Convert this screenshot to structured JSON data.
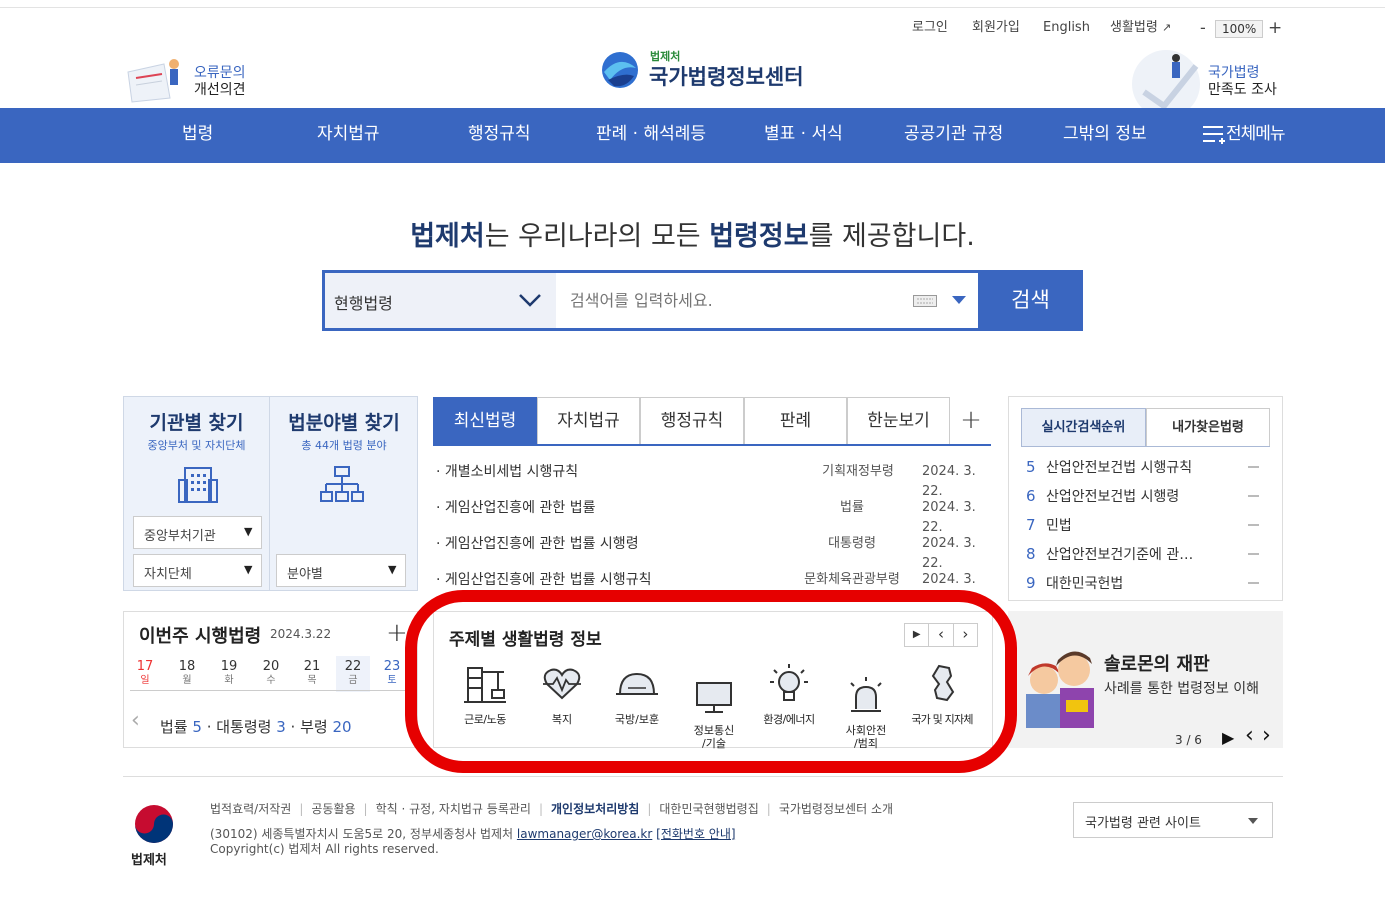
{
  "util": {
    "login": "로그인",
    "join": "회원가입",
    "english": "English",
    "life": "생활법령",
    "zoom": "100%",
    "minus": "-",
    "plus": "+"
  },
  "header": {
    "feedback1": "오류문의",
    "feedback2": "개선의견",
    "logo_small": "법제처",
    "logo": "국가법령정보센터",
    "survey1": "국가법령",
    "survey2": "만족도 조사"
  },
  "nav": [
    "법령",
    "자치법규",
    "행정규칙",
    "판례 · 해석례등",
    "별표 · 서식",
    "공공기관 규정",
    "그밖의 정보",
    "전체메뉴"
  ],
  "slogan": {
    "b1": "법제처",
    "t1": "는 우리나라의 모든 ",
    "b2": "법령정보",
    "t2": "를 제공합니다."
  },
  "search": {
    "category": "현행법령",
    "placeholder": "검색어를 입력하세요.",
    "button": "검색"
  },
  "finder": {
    "org_title": "기관별 찾기",
    "org_sub": "중앙부처 및 자치단체",
    "field_title": "법분야별 찾기",
    "field_sub": "총 44개 법령 분야",
    "sel1": "중앙부처기관",
    "sel2": "자치단체",
    "sel3": "분야별"
  },
  "tabs": [
    "최신법령",
    "자치법규",
    "행정규칙",
    "판례",
    "한눈보기",
    "+"
  ],
  "new_laws": [
    {
      "title": "· 개별소비세법 시행규칙",
      "type": "기획재정부령",
      "date": "2024. 3. 22."
    },
    {
      "title": "· 게임산업진흥에 관한 법률",
      "type": "법률",
      "date": "2024. 3. 22."
    },
    {
      "title": "· 게임산업진흥에 관한 법률 시행령",
      "type": "대통령령",
      "date": "2024. 3. 22."
    },
    {
      "title": "· 게임산업진흥에 관한 법률 시행규칙",
      "type": "문화체육관광부령",
      "date": "2024. 3. 22."
    }
  ],
  "rank": {
    "tab1": "실시간검색순위",
    "tab2": "내가찾은법령",
    "items": [
      {
        "n": "5",
        "t": "산업안전보건법 시행규칙"
      },
      {
        "n": "6",
        "t": "산업안전보건법 시행령"
      },
      {
        "n": "7",
        "t": "민법"
      },
      {
        "n": "8",
        "t": "산업안전보건기준에 관…"
      },
      {
        "n": "9",
        "t": "대한민국헌법"
      }
    ]
  },
  "week": {
    "title": "이번주 시행법령",
    "date": "2024.3.22",
    "plus": "+",
    "days": [
      {
        "d": "17",
        "w": "일"
      },
      {
        "d": "18",
        "w": "월"
      },
      {
        "d": "19",
        "w": "화"
      },
      {
        "d": "20",
        "w": "수"
      },
      {
        "d": "21",
        "w": "목"
      },
      {
        "d": "22",
        "w": "금"
      },
      {
        "d": "23",
        "w": "토"
      }
    ],
    "counts": {
      "l1": "법률",
      "c1": "5",
      "l2": "대통령령",
      "c2": "3",
      "l3": "부령",
      "c3": "20"
    }
  },
  "topics": {
    "title": "주제별 생활법령 정보",
    "items": [
      {
        "label": "근로/노동",
        "icon": "construction-icon"
      },
      {
        "label": "복지",
        "icon": "heart-icon"
      },
      {
        "label": "국방/보훈",
        "icon": "helmet-icon"
      },
      {
        "label": "정보통신\n/기술",
        "icon": "monitor-icon"
      },
      {
        "label": "환경/에너지",
        "icon": "bulb-icon"
      },
      {
        "label": "사회안전\n/범죄",
        "icon": "siren-icon"
      },
      {
        "label": "국가 및 지자체",
        "icon": "korea-map-icon"
      }
    ]
  },
  "banner": {
    "title": "솔로몬의 재판",
    "sub": "사례를 통한 법령정보 이해",
    "page": "3 / 6"
  },
  "footer": {
    "links": [
      "법적효력/저작권",
      "공동활용",
      "학칙 · 규정, 자치법규 등록관리",
      "개인정보처리방침",
      "대한민국현행법령집",
      "국가법령정보센터 소개"
    ],
    "addr": "(30102) 세종특별자치시 도움5로 20, 정부세종청사 법제처 ",
    "email": "lawmanager@korea.kr",
    "phone": "[전화번호 안내]",
    "copy": "Copyright(c) 법제처 All rights reserved.",
    "org": "법제처",
    "sites": "국가법령 관련 사이트"
  },
  "colors": {
    "nav": "#3a66c0",
    "highlight": "#e60000"
  }
}
